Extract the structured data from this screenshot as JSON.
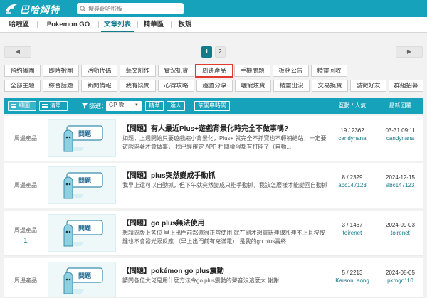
{
  "header": {
    "logo_text": "巴哈姆特",
    "search_placeholder": "搜尋此哈啦板"
  },
  "nav": {
    "tabs": [
      {
        "label": "哈啦區",
        "active": false
      },
      {
        "label": "Pokemon GO",
        "active": false
      },
      {
        "label": "文章列表",
        "active": true
      },
      {
        "label": "精華區",
        "active": false
      },
      {
        "label": "板規",
        "active": false
      }
    ]
  },
  "pager": {
    "prev": "◀",
    "next": "▶",
    "pages": [
      "1",
      "2"
    ],
    "current": "1"
  },
  "categories": {
    "row1": [
      "預約揪團",
      "即時揪團",
      "活動代碼",
      "藝文創作",
      "實況抓寶",
      "周邊產品",
      "手機問題",
      "板務公告",
      "精靈回收"
    ],
    "row2": [
      "全部主題",
      "綜合話題",
      "新聞情報",
      "我有疑問",
      "心得攻略",
      "趣圖分享",
      "曬寵炫寶",
      "精靈出沒",
      "交易換寶",
      "誠徵好友",
      "群組招募"
    ],
    "highlighted": "周邊產品"
  },
  "table_header": {
    "view_detail": "細圖",
    "view_list": "清單",
    "filter_label": "篩選：",
    "filter_select": "GP 數",
    "btn_jinghua": "精華",
    "btn_daren": "達人",
    "btn_time": "依開串時間",
    "col_stats": "互動 / 人氣",
    "col_last": "最新回覆"
  },
  "rows": [
    {
      "category": "周邊產品",
      "n": "",
      "title": "【問題】有人最近Plus+遊戲背景化時完全不做事嗎?",
      "excerpt": "如題，上週開始只要遊戲縮小背景化，Plus+ 就完全不抓寶也不轉補給站，一定要遊戲開著才會做事， 我已經確定 APP 相關權限都有打開了（自動...",
      "stats": "19 / 2362",
      "author": "candynana",
      "last_time": "03-31 09:11",
      "last_user": "candynana"
    },
    {
      "category": "周邊產品",
      "n": "",
      "title": "【問題】plus突然變成手動抓",
      "excerpt": "我早上還可以自動抓，但下午就突然變成只能手動抓，我該怎麼樣才能變回自動抓",
      "stats": "8 / 2329",
      "author": "abc147123",
      "last_time": "2024-12-15",
      "last_user": "abc147123"
    },
    {
      "category": "周邊產品",
      "n": "1",
      "title": "【問題】go plus無法使用",
      "excerpt": "想請問版上各位 早上出門前都還很正常使用 就在剛才想重新連線卻連不上且按按鍵也不會發光跟反應 （早上出門前有充滿電） 是我的go plus壽終...",
      "stats": "3 / 1467",
      "author": "toirenet",
      "last_time": "2024-09-03",
      "last_user": "toirenet"
    },
    {
      "category": "周邊產品",
      "n": "",
      "title": "【問題】pokémon go plus震動",
      "excerpt": "請問各位大佬是用什麼方法令go plus震動的聲音沒這麼大 謝謝",
      "stats": "5 / 2213",
      "author": "KarsonLeong",
      "last_time": "2024-08-05",
      "last_user": "pkmgo110"
    }
  ],
  "thumb_label": "問題",
  "colors": {
    "brand": "#16a2ba",
    "accent": "#117a8b",
    "highlight_border": "#e23b2e"
  }
}
